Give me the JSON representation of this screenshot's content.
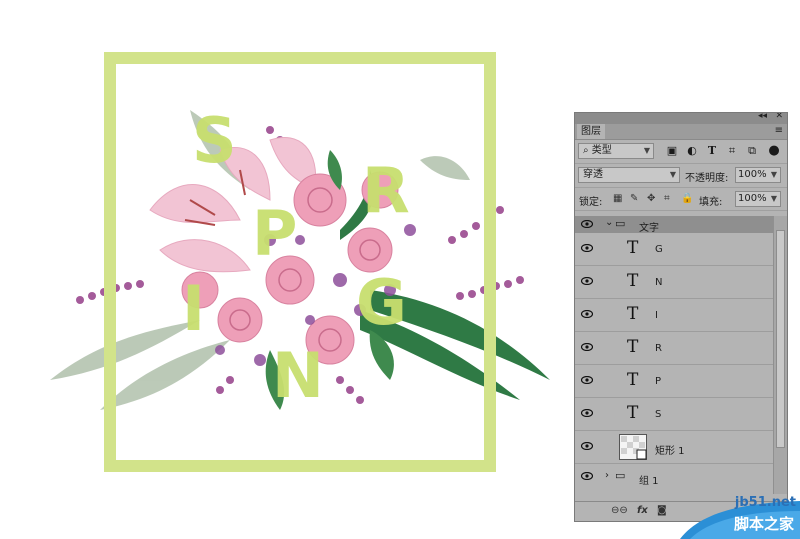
{
  "artwork": {
    "letters": [
      "S",
      "P",
      "R",
      "I",
      "N",
      "G"
    ],
    "frame_color": "#d2e38a",
    "letter_color": "#c8df6f"
  },
  "panel": {
    "title_buttons": [
      "◂◂",
      "✕"
    ],
    "tab_label": "图层",
    "filter": {
      "prefix_icon": "search-icon",
      "label": "类型"
    },
    "blend_mode": "穿透",
    "opacity_label": "不透明度:",
    "opacity_value": "100%",
    "lock_label": "锁定:",
    "fill_label": "填充:",
    "fill_value": "100%",
    "group": {
      "name": "文字"
    },
    "layers": [
      {
        "type": "text",
        "name": "G"
      },
      {
        "type": "text",
        "name": "N"
      },
      {
        "type": "text",
        "name": "I"
      },
      {
        "type": "text",
        "name": "R"
      },
      {
        "type": "text",
        "name": "P"
      },
      {
        "type": "text",
        "name": "S"
      },
      {
        "type": "shape",
        "name": "矩形 1"
      },
      {
        "type": "group",
        "name": "组 1"
      }
    ],
    "footer_icons": [
      "link-icon",
      "fx-icon",
      "mask-icon"
    ],
    "footer_fx": "fx"
  },
  "watermark": {
    "url": "jb51.net",
    "text": "脚本之家"
  }
}
